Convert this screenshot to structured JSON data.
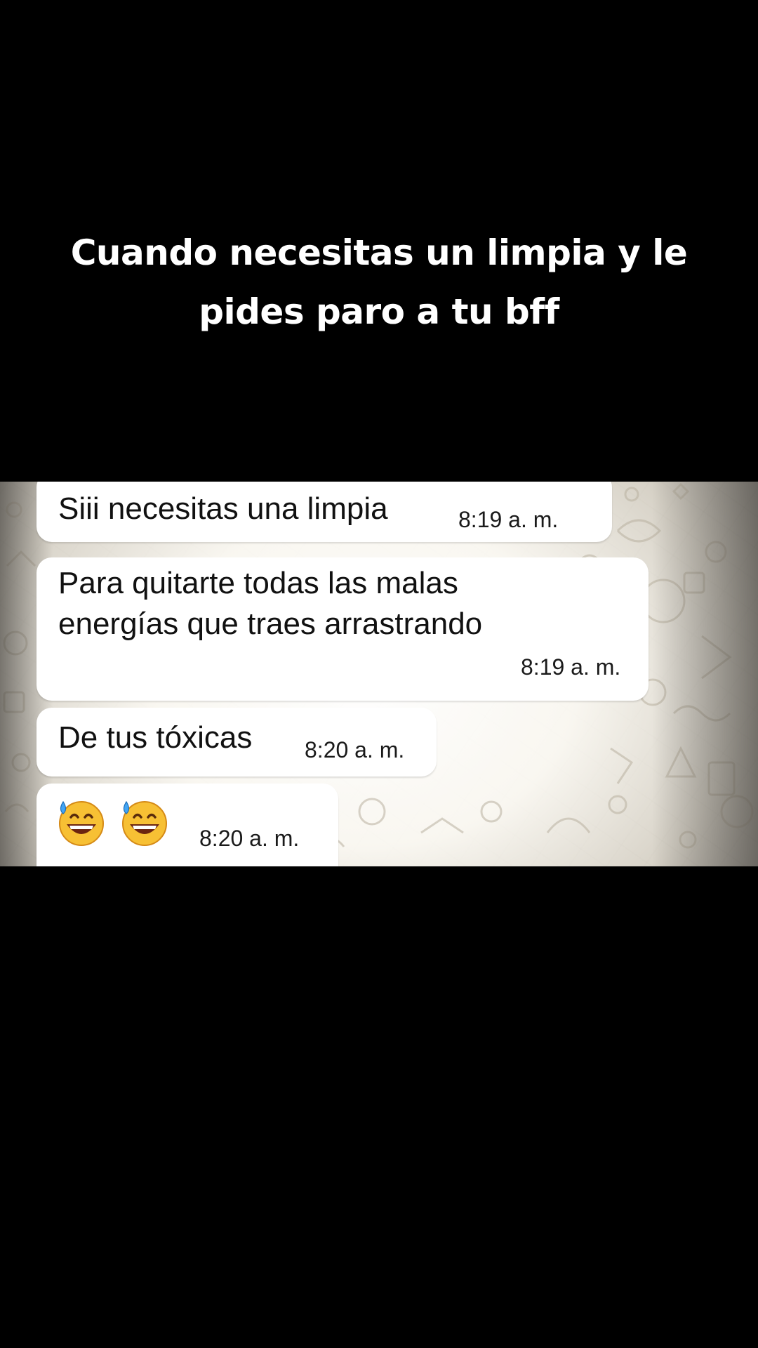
{
  "caption": {
    "line1": "Cuando necesitas un limpia y le",
    "line2": "pides paro a tu bff"
  },
  "chat": {
    "messages": [
      {
        "text": "Siii necesitas una limpia",
        "time": "8:19 a. m."
      },
      {
        "line1": "Para quitarte todas las malas",
        "line2": "energías que traes arrastrando",
        "time": "8:19 a. m."
      },
      {
        "text": "De tus tóxicas",
        "time": "8:20 a. m."
      },
      {
        "emojis": [
          "grinning-face-with-sweat",
          "grinning-face-with-sweat"
        ],
        "time": "8:20 a. m."
      }
    ]
  }
}
